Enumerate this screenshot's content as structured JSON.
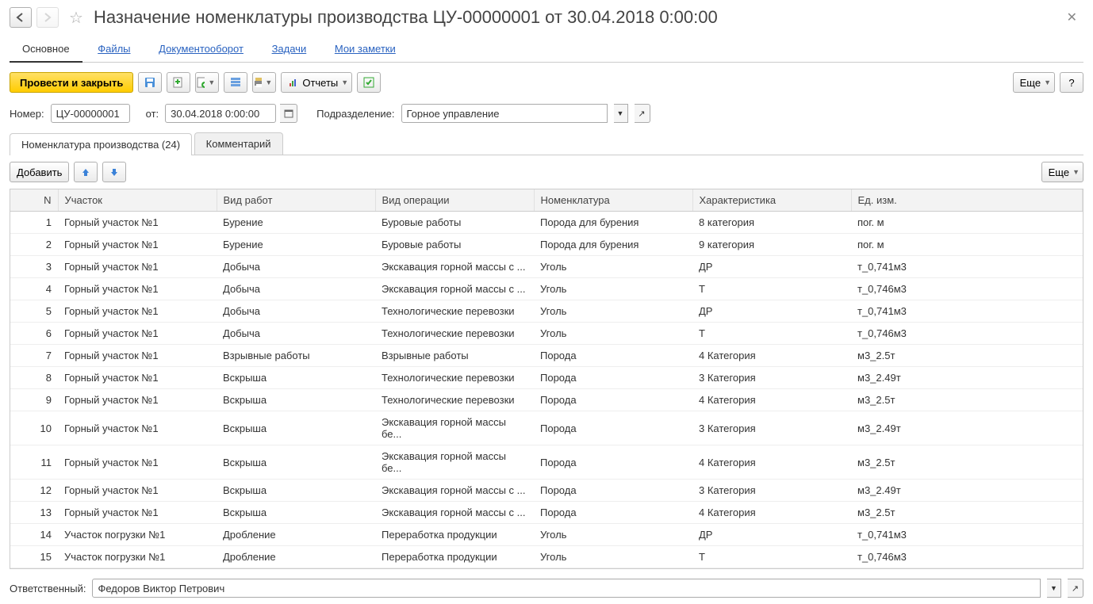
{
  "header": {
    "title": "Назначение номенклатуры производства ЦУ-00000001 от 30.04.2018 0:00:00"
  },
  "sections": {
    "main": "Основное",
    "files": "Файлы",
    "docflow": "Документооборот",
    "tasks": "Задачи",
    "notes": "Мои заметки"
  },
  "toolbar": {
    "post_and_close": "Провести и закрыть",
    "reports": "Отчеты",
    "more": "Еще",
    "help": "?"
  },
  "form": {
    "number_label": "Номер:",
    "number_value": "ЦУ-00000001",
    "from_label": "от:",
    "date_value": "30.04.2018  0:00:00",
    "dept_label": "Подразделение:",
    "dept_value": "Горное управление"
  },
  "tabs": {
    "tab1": "Номенклатура производства (24)",
    "tab2": "Комментарий"
  },
  "sub_toolbar": {
    "add": "Добавить",
    "more": "Еще"
  },
  "table": {
    "headers": {
      "n": "N",
      "uchastok": "Участок",
      "vid_rabot": "Вид работ",
      "vid_oper": "Вид операции",
      "nomen": "Номенклатура",
      "charact": "Характеристика",
      "unit": "Ед. изм."
    },
    "rows": [
      {
        "n": "1",
        "uch": "Горный участок №1",
        "vid": "Бурение",
        "oper": "Буровые работы",
        "nom": "Порода для бурения",
        "char": "8 категория",
        "unit": "пог. м"
      },
      {
        "n": "2",
        "uch": "Горный участок №1",
        "vid": "Бурение",
        "oper": "Буровые работы",
        "nom": "Порода для бурения",
        "char": "9 категория",
        "unit": "пог. м"
      },
      {
        "n": "3",
        "uch": "Горный участок №1",
        "vid": "Добыча",
        "oper": "Экскавация горной массы с ...",
        "nom": "Уголь",
        "char": "ДР",
        "unit": "т_0,741м3"
      },
      {
        "n": "4",
        "uch": "Горный участок №1",
        "vid": "Добыча",
        "oper": "Экскавация горной массы с ...",
        "nom": "Уголь",
        "char": "Т",
        "unit": "т_0,746м3"
      },
      {
        "n": "5",
        "uch": "Горный участок №1",
        "vid": "Добыча",
        "oper": "Технологические перевозки",
        "nom": "Уголь",
        "char": "ДР",
        "unit": "т_0,741м3"
      },
      {
        "n": "6",
        "uch": "Горный участок №1",
        "vid": "Добыча",
        "oper": "Технологические перевозки",
        "nom": "Уголь",
        "char": "Т",
        "unit": "т_0,746м3"
      },
      {
        "n": "7",
        "uch": "Горный участок №1",
        "vid": "Взрывные работы",
        "oper": "Взрывные работы",
        "nom": "Порода",
        "char": "4 Категория",
        "unit": "м3_2.5т"
      },
      {
        "n": "8",
        "uch": "Горный участок №1",
        "vid": "Вскрыша",
        "oper": "Технологические перевозки",
        "nom": "Порода",
        "char": "3 Категория",
        "unit": "м3_2.49т"
      },
      {
        "n": "9",
        "uch": "Горный участок №1",
        "vid": "Вскрыша",
        "oper": "Технологические перевозки",
        "nom": "Порода",
        "char": "4 Категория",
        "unit": "м3_2.5т"
      },
      {
        "n": "10",
        "uch": "Горный участок №1",
        "vid": "Вскрыша",
        "oper": "Экскавация горной массы бе...",
        "nom": "Порода",
        "char": "3 Категория",
        "unit": "м3_2.49т"
      },
      {
        "n": "11",
        "uch": "Горный участок №1",
        "vid": "Вскрыша",
        "oper": "Экскавация горной массы бе...",
        "nom": "Порода",
        "char": "4 Категория",
        "unit": "м3_2.5т"
      },
      {
        "n": "12",
        "uch": "Горный участок №1",
        "vid": "Вскрыша",
        "oper": "Экскавация горной массы с ...",
        "nom": "Порода",
        "char": "3 Категория",
        "unit": "м3_2.49т"
      },
      {
        "n": "13",
        "uch": "Горный участок №1",
        "vid": "Вскрыша",
        "oper": "Экскавация горной массы с ...",
        "nom": "Порода",
        "char": "4 Категория",
        "unit": "м3_2.5т"
      },
      {
        "n": "14",
        "uch": "Участок погрузки №1",
        "vid": "Дробление",
        "oper": "Переработка продукции",
        "nom": "Уголь",
        "char": "ДР",
        "unit": "т_0,741м3"
      },
      {
        "n": "15",
        "uch": "Участок погрузки №1",
        "vid": "Дробление",
        "oper": "Переработка продукции",
        "nom": "Уголь",
        "char": "Т",
        "unit": "т_0,746м3"
      }
    ]
  },
  "responsible": {
    "label": "Ответственный:",
    "value": "Федоров Виктор Петрович"
  }
}
